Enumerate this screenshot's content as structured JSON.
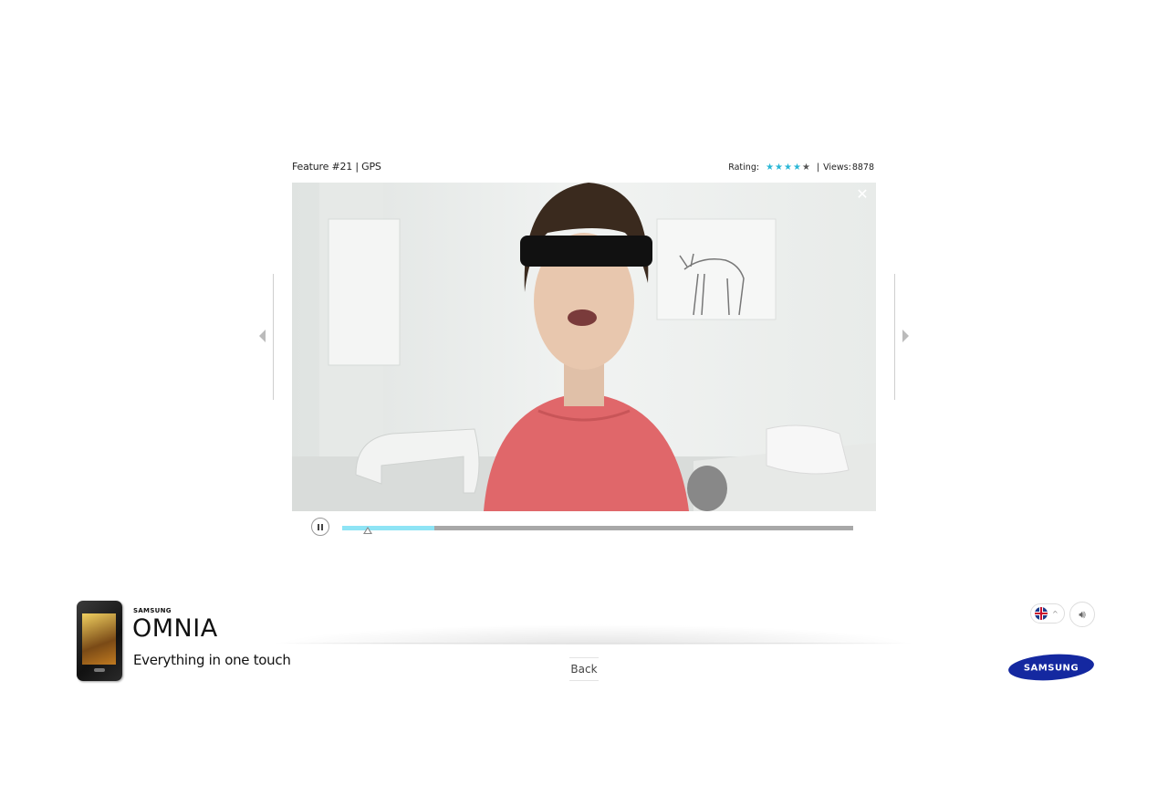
{
  "feature": {
    "title": "Feature #21 | GPS"
  },
  "stats": {
    "rating_label": "Rating:",
    "rating_value": 4,
    "rating_max": 5,
    "separator": "|",
    "views_label": "Views:",
    "views_value": "8878"
  },
  "player": {
    "close_icon": "close-icon",
    "progress_fraction": 0.18,
    "playhead_fraction": 0.05,
    "state": "playing"
  },
  "brand": {
    "maker": "SAMSUNG",
    "product": "OMNIA",
    "tagline": "Everything in one touch",
    "logo_text": "SAMSUNG"
  },
  "footer": {
    "back_label": "Back",
    "language_caret": "^"
  },
  "colors": {
    "accent": "#2ab7d6",
    "progress": "#8ee4f5",
    "samsung_blue": "#1428a0"
  }
}
